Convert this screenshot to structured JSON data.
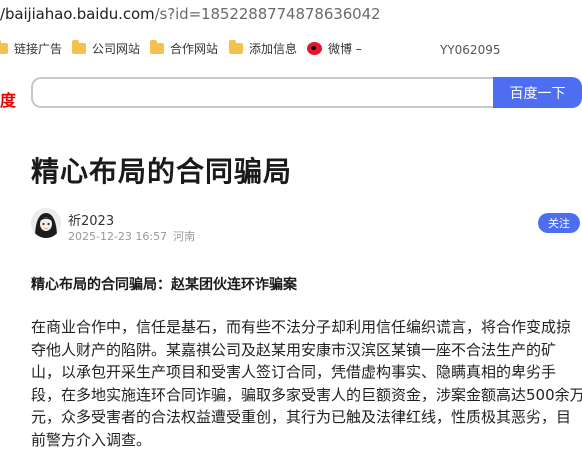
{
  "browser": {
    "url_host": "/baijiahao.baidu.com",
    "url_path": "/s?id=1852288774878636042",
    "bookmarks": [
      {
        "label": "链接广告",
        "icon": "folder-icon"
      },
      {
        "label": "公司网站",
        "icon": "folder-icon"
      },
      {
        "label": "合作网站",
        "icon": "folder-icon"
      },
      {
        "label": "添加信息",
        "icon": "folder-icon"
      },
      {
        "label": "微博 –",
        "icon": "weibo-icon"
      }
    ],
    "extra_label": "YY062095"
  },
  "search": {
    "logo_fragment": "度",
    "query": "",
    "button_label": "百度一下"
  },
  "article": {
    "title": "精心布局的合同骗局",
    "author": "祈2023",
    "date": "2025-12-23 16:57",
    "location": "河南",
    "follow_label": "关注",
    "subheading": "精心布局的合同骗局：赵某团伙连环诈骗案",
    "paragraph_lines": [
      "在商业合作中，信任是基石，而有些不法分子却利用信任编织谎言，将合作变成掠",
      "夺他人财产的陷阱。某嘉祺公司及赵某用安康市汉滨区某镇一座不合法生产的矿",
      "山，以承包开采生产项目和受害人签订合同，凭借虚构事实、隐瞒真相的卑劣手",
      "段，在多地实施连环合同诈骗，骗取多家受害人的巨额资金，涉案金额高达500余万",
      "元，众多受害者的合法权益遭受重创，其行为已触及法律红线，性质极其恶劣，目",
      "前警方介入调查。"
    ]
  }
}
